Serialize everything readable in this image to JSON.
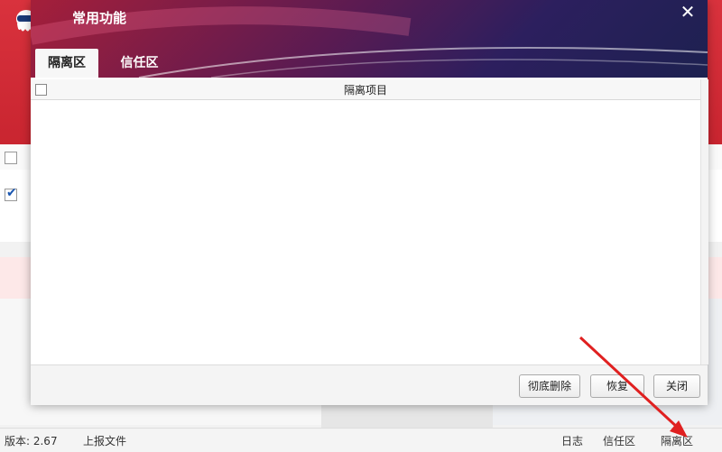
{
  "dialog": {
    "title": "常用功能",
    "close_glyph": "✕",
    "tabs": [
      {
        "label": "隔离区",
        "active": true
      },
      {
        "label": "信任区",
        "active": false
      }
    ],
    "list_header": "隔离项目",
    "buttons": {
      "delete": "彻底删除",
      "restore": "恢复",
      "close": "关闭"
    }
  },
  "statusbar": {
    "version": "版本: 2.67",
    "report": "上报文件",
    "log": "日志",
    "trust": "信任区",
    "quarantine": "隔离区"
  },
  "background_app": {
    "row_checked": true
  },
  "icons": {
    "logo": "ghost-robot-logo-icon",
    "close": "close-icon",
    "annotation": "red-arrow-icon"
  },
  "colors": {
    "brand_red": "#d9323d",
    "header_dark": "#2c1f5e",
    "arrow": "#e02020"
  }
}
